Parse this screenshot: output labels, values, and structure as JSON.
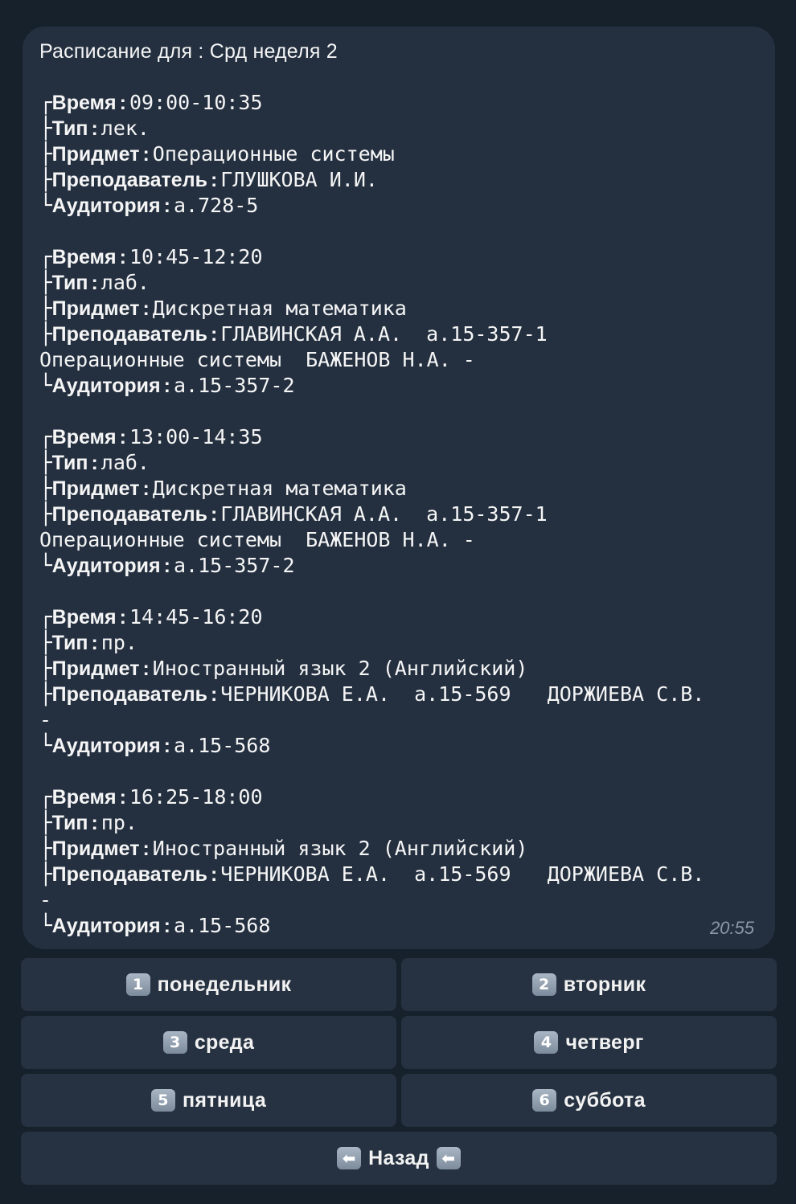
{
  "message": {
    "header": "Расписание для : Срд неделя 2",
    "time": "20:55",
    "labels": {
      "time": "Время",
      "type": "Тип",
      "subject": "Придмет",
      "teacher": "Преподаватель",
      "room": "Аудитория"
    },
    "separator": ":",
    "glyphs": {
      "first": "┌",
      "middle": "├",
      "last": "└"
    },
    "lessons": [
      {
        "time": "09:00-10:35",
        "type": "лек.",
        "subject": "Операционные системы",
        "teacher": "ГЛУШКОВА И.И.",
        "teacher_cont": "",
        "room": "а.728-5"
      },
      {
        "time": "10:45-12:20",
        "type": "лаб.",
        "subject": "Дискретная математика",
        "teacher": "ГЛАВИНСКАЯ А.А.  а.15-357-1",
        "teacher_cont": "Операционные системы  БАЖЕНОВ Н.А. -",
        "room": "а.15-357-2"
      },
      {
        "time": "13:00-14:35",
        "type": "лаб.",
        "subject": "Дискретная математика",
        "teacher": "ГЛАВИНСКАЯ А.А.  а.15-357-1",
        "teacher_cont": "Операционные системы  БАЖЕНОВ Н.А. -",
        "room": "а.15-357-2"
      },
      {
        "time": "14:45-16:20",
        "type": "пр.",
        "subject": "Иностранный язык 2 (Английский)",
        "teacher": "ЧЕРНИКОВА Е.А.  а.15-569   ДОРЖИЕВА С.В.",
        "teacher_cont": "-",
        "room": "а.15-568"
      },
      {
        "time": "16:25-18:00",
        "type": "пр.",
        "subject": "Иностранный язык 2 (Английский)",
        "teacher": "ЧЕРНИКОВА Е.А.  а.15-569   ДОРЖИЕВА С.В.",
        "teacher_cont": "-",
        "room": "а.15-568"
      }
    ]
  },
  "keyboard": {
    "rows": [
      [
        {
          "keycap": "1",
          "label": "понедельник"
        },
        {
          "keycap": "2",
          "label": "вторник"
        }
      ],
      [
        {
          "keycap": "3",
          "label": "среда"
        },
        {
          "keycap": "4",
          "label": "четверг"
        }
      ],
      [
        {
          "keycap": "5",
          "label": "пятница"
        },
        {
          "keycap": "6",
          "label": "суббота"
        }
      ]
    ],
    "back": {
      "label": "Назад",
      "icon_left": "left-arrow-icon",
      "icon_right": "left-arrow-icon",
      "arrow_glyph": "⬅"
    }
  },
  "colors": {
    "background": "#17212b",
    "bubble": "#243040",
    "button": "#263241",
    "text": "#f5f5f5",
    "time": "#8b97a6"
  }
}
